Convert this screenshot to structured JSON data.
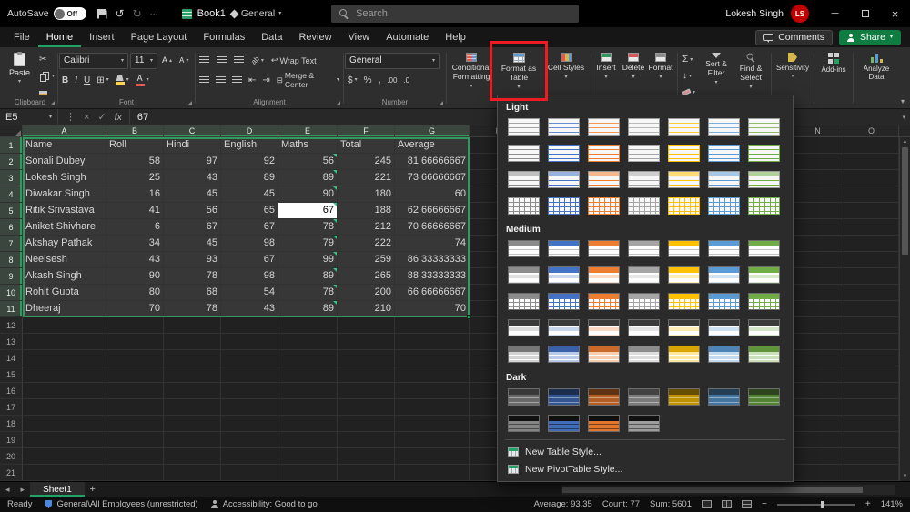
{
  "titlebar": {
    "autosave_label": "AutoSave",
    "autosave_state": "Off",
    "workbook_name": "Book1",
    "sensitivity_label": "General",
    "search_placeholder": "Search",
    "user_name": "Lokesh Singh",
    "user_initials": "LS"
  },
  "ribbon_tabs": [
    "File",
    "Home",
    "Insert",
    "Page Layout",
    "Formulas",
    "Data",
    "Review",
    "View",
    "Automate",
    "Help"
  ],
  "header_actions": {
    "comments": "Comments",
    "share": "Share"
  },
  "ribbon": {
    "clipboard": {
      "paste": "Paste",
      "label": "Clipboard"
    },
    "font": {
      "name": "Calibri",
      "size": "11",
      "label": "Font"
    },
    "alignment": {
      "wrap_text": "Wrap Text",
      "merge_center": "Merge & Center",
      "label": "Alignment"
    },
    "number": {
      "format": "General",
      "label": "Number"
    },
    "styles": {
      "conditional_formatting": "Conditional Formatting",
      "format_as_table": "Format as Table",
      "cell_styles": "Cell Styles"
    },
    "cells": {
      "insert": "Insert",
      "delete": "Delete",
      "format": "Format"
    },
    "editing": {
      "sort_filter": "Sort & Filter",
      "find_select": "Find & Select"
    },
    "sensitivity": "Sensitivity",
    "addins": "Add-ins",
    "analyze": "Analyze Data"
  },
  "formula_bar": {
    "cell_reference": "E5",
    "formula_value": "67"
  },
  "grid": {
    "columns": [
      "A",
      "B",
      "C",
      "D",
      "E",
      "F",
      "G",
      "H",
      "I",
      "J",
      "K",
      "L",
      "M",
      "N",
      "O"
    ],
    "row_count": 21,
    "selected_columns": 7,
    "selected_rows": 11,
    "active_cell": {
      "row": 5,
      "col": 4,
      "reference": "E5"
    }
  },
  "table": {
    "headers": [
      "Name",
      "Roll",
      "Hindi",
      "English",
      "Maths",
      "Total",
      "Average"
    ],
    "rows": [
      [
        "Sonali Dubey",
        "58",
        "97",
        "92",
        "56",
        "245",
        "81.66666667"
      ],
      [
        "Lokesh Singh",
        "25",
        "43",
        "89",
        "89",
        "221",
        "73.66666667"
      ],
      [
        "Diwakar Singh",
        "16",
        "45",
        "45",
        "90",
        "180",
        "60"
      ],
      [
        "Ritik Srivastava",
        "41",
        "56",
        "65",
        "67",
        "188",
        "62.66666667"
      ],
      [
        "Aniket Shivhare",
        "6",
        "67",
        "67",
        "78",
        "212",
        "70.66666667"
      ],
      [
        "Akshay Pathak",
        "34",
        "45",
        "98",
        "79",
        "222",
        "74"
      ],
      [
        "Neelsesh",
        "43",
        "93",
        "67",
        "99",
        "259",
        "86.33333333"
      ],
      [
        "Akash Singh",
        "90",
        "78",
        "98",
        "89",
        "265",
        "88.33333333"
      ],
      [
        "Rohit Gupta",
        "80",
        "68",
        "54",
        "78",
        "200",
        "66.66666667"
      ],
      [
        "Dheeraj",
        "70",
        "78",
        "43",
        "89",
        "210",
        "70"
      ]
    ]
  },
  "format_table_panel": {
    "sections": [
      {
        "name": "Light",
        "row_counts": [
          7,
          7,
          7,
          7
        ]
      },
      {
        "name": "Medium",
        "row_counts": [
          7,
          7,
          7,
          7,
          7
        ]
      },
      {
        "name": "Dark",
        "row_counts": [
          7,
          4
        ]
      }
    ],
    "accent_colors": [
      "#8c8c8c",
      "#4472c4",
      "#ed7d31",
      "#a5a5a5",
      "#ffc000",
      "#5b9bd5",
      "#70ad47"
    ],
    "footer_items": [
      "New Table Style...",
      "New PivotTable Style..."
    ]
  },
  "sheet_tabs": {
    "active_tab": "Sheet1"
  },
  "status_bar": {
    "ready": "Ready",
    "sensitivity_label": "General\\All Employees (unrestricted)",
    "accessibility": "Accessibility: Good to go",
    "average": "Average: 93.35",
    "count": "Count: 77",
    "sum": "Sum: 5601",
    "zoom": "141%"
  },
  "colors": {
    "excel_green": "#21a366",
    "selection_green": "#2e9b5d",
    "highlight_red": "#ed1c24",
    "avatar_red": "#c00000"
  },
  "icons": {
    "chevron_down": "▾",
    "caret_up": "▴",
    "undo": "↺",
    "redo": "↻",
    "scissors": "✂",
    "sigma": "Σ",
    "borders": "⊞",
    "merge": "⊟",
    "wrap_return": "↩",
    "orientation_arrow": "↗",
    "outdent": "⇤",
    "indent": "⇥",
    "dollar": "$",
    "percent": "%",
    "comma": ",",
    "increase_decimal": ".00",
    "decrease_decimal": ".0",
    "bold": "B",
    "italic": "I",
    "underline": "U",
    "close": "×",
    "minimize": "─",
    "fx": "fx",
    "check": "✓",
    "cancel": "×",
    "name_menu": "⋮",
    "launcher": "◢",
    "fill_down": "↓",
    "tab_prev": "◂",
    "tab_next": "▸",
    "add_sheet": "+",
    "minus": "−",
    "plus": "+",
    "collapse": "▾",
    "more": "⋯"
  }
}
